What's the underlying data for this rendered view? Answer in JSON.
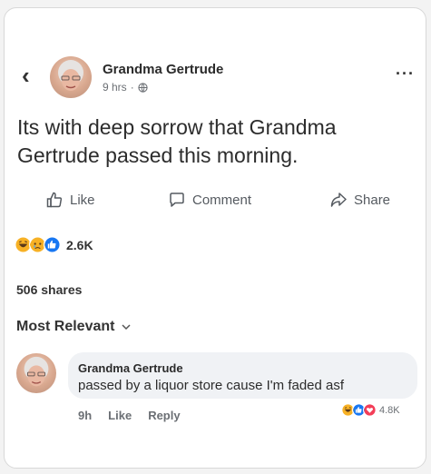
{
  "post": {
    "author": "Grandma Gertrude",
    "time": "9 hrs",
    "dot": "·",
    "privacy_icon": "globe-icon",
    "text": "Its with deep sorrow that Grandma Gertrude passed this morning."
  },
  "actions": {
    "like": "Like",
    "comment": "Comment",
    "share": "Share"
  },
  "reactions": {
    "icons": [
      "haha",
      "sad",
      "like"
    ],
    "count": "2.6K"
  },
  "shares": "506 shares",
  "comments_sort": {
    "label": "Most Relevant"
  },
  "comment": {
    "author": "Grandma Gertrude",
    "text": "passed by a liquor store cause I'm faded asf",
    "time": "9h",
    "like": "Like",
    "reply": "Reply",
    "reactions": [
      "haha",
      "like",
      "love"
    ],
    "reaction_count": "4.8K"
  },
  "colors": {
    "like_blue": "#1877f2",
    "love_red": "#f33e58",
    "haha_yellow": "#f7b125",
    "bubble_bg": "#f0f2f5"
  }
}
